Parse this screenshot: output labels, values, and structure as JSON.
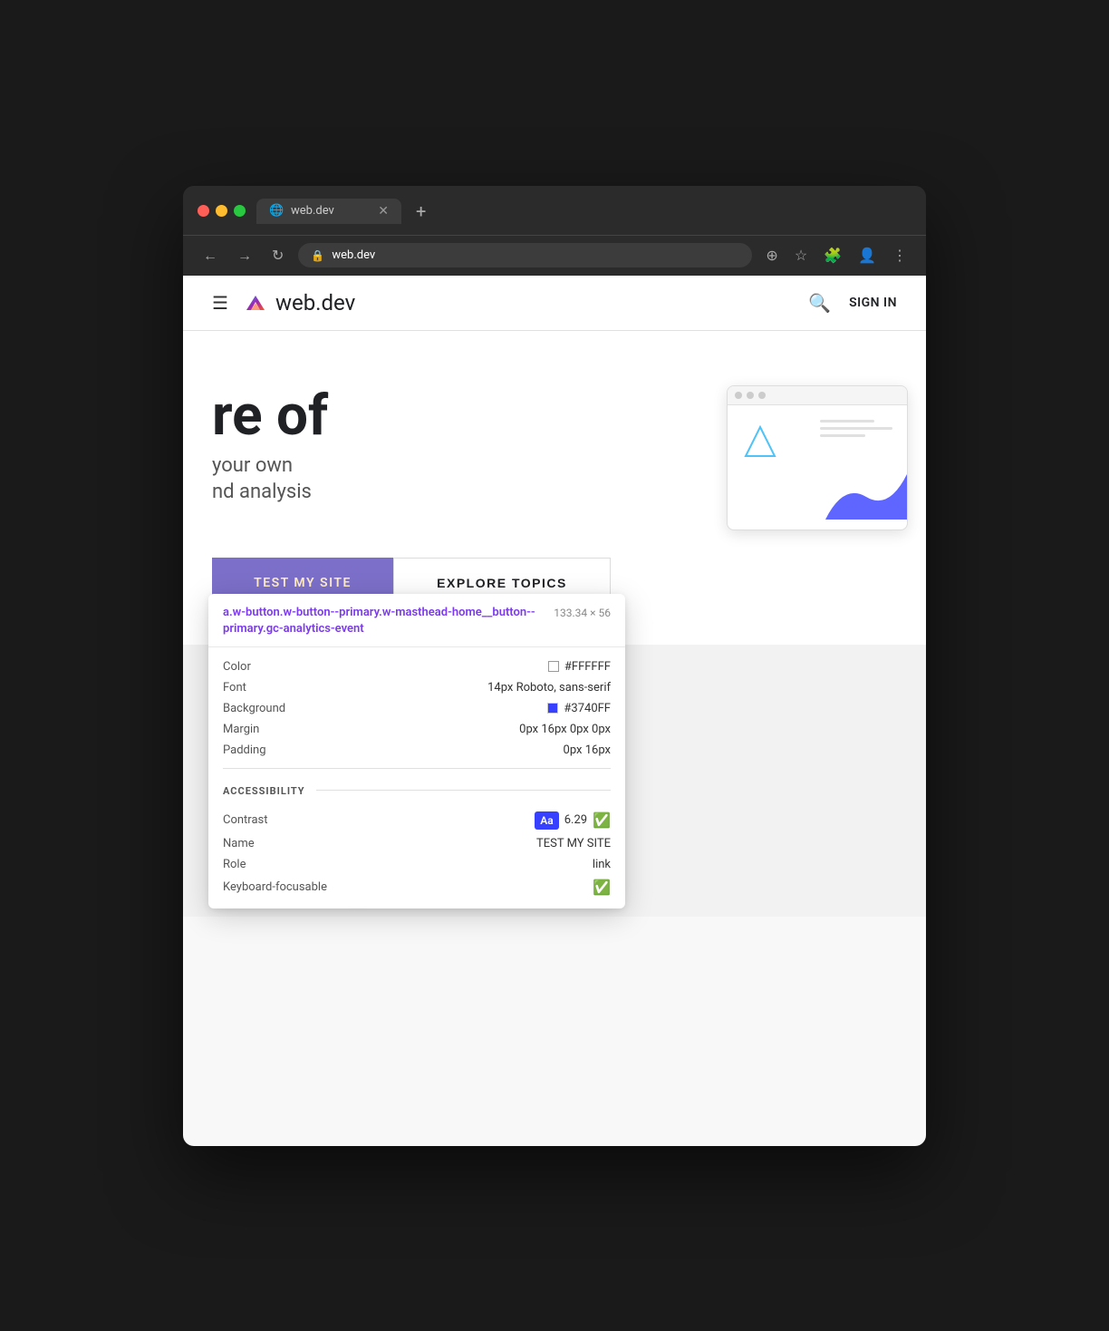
{
  "browser": {
    "tab_title": "web.dev",
    "tab_favicon": "🌐",
    "close_label": "✕",
    "new_tab_label": "+",
    "address": "web.dev",
    "nav_back": "←",
    "nav_forward": "→",
    "nav_refresh": "↻"
  },
  "site_header": {
    "hamburger_label": "☰",
    "logo_text": "web.dev",
    "search_label": "🔍",
    "signin_label": "SIGN IN"
  },
  "hero": {
    "text_large_1": "re of",
    "text_sub_1": "your own",
    "text_sub_2": "nd analysis"
  },
  "buttons": {
    "primary_label": "TEST MY SITE",
    "secondary_label": "EXPLORE TOPICS"
  },
  "inspector": {
    "selector": "a.w-button.w-button--primary.w-masthead-home__button--primary.gc-analytics-event",
    "dimensions": "133.34 × 56",
    "properties": {
      "color_label": "Color",
      "color_value": "#FFFFFF",
      "font_label": "Font",
      "font_value": "14px Roboto, sans-serif",
      "background_label": "Background",
      "background_value": "#3740FF",
      "margin_label": "Margin",
      "margin_value": "0px 16px 0px 0px",
      "padding_label": "Padding",
      "padding_value": "0px 16px"
    },
    "accessibility": {
      "section_label": "ACCESSIBILITY",
      "contrast_label": "Contrast",
      "contrast_badge": "Aa",
      "contrast_value": "6.29",
      "name_label": "Name",
      "name_value": "TEST MY SITE",
      "role_label": "Role",
      "role_value": "link",
      "keyboard_label": "Keyboard-focusable",
      "keyboard_value": "✓"
    }
  }
}
